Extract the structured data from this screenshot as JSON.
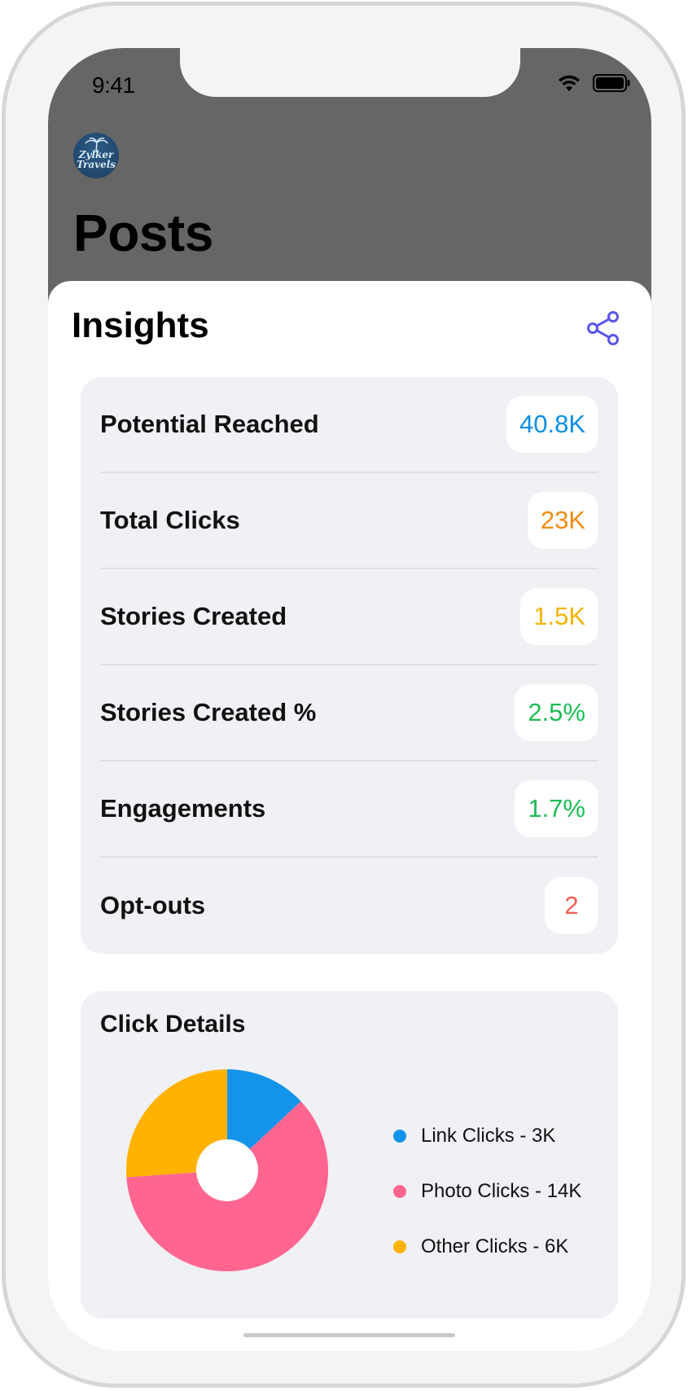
{
  "status": {
    "time": "9:41"
  },
  "header": {
    "title": "Posts",
    "avatar_line1": "Zylker",
    "avatar_line2": "Travels"
  },
  "insights": {
    "title": "Insights",
    "share_icon": "share-icon",
    "stats": [
      {
        "label": "Potential Reached",
        "value": "40.8K",
        "color": "#0a8ee6"
      },
      {
        "label": "Total Clicks",
        "value": "23K",
        "color": "#f28c0f"
      },
      {
        "label": "Stories Created",
        "value": "1.5K",
        "color": "#f5b400"
      },
      {
        "label": "Stories Created %",
        "value": "2.5%",
        "color": "#1cbd55"
      },
      {
        "label": "Engagements",
        "value": "1.7%",
        "color": "#1cbd55"
      },
      {
        "label": "Opt-outs",
        "value": "2",
        "color": "#f35b55"
      }
    ]
  },
  "click_details": {
    "title": "Click Details",
    "legend": [
      "Link Clicks - 3K",
      "Photo Clicks - 14K",
      "Other Clicks - 6K"
    ]
  },
  "chart_data": {
    "type": "pie",
    "donut": true,
    "categories": [
      "Link Clicks",
      "Photo Clicks",
      "Other Clicks"
    ],
    "values": [
      3,
      14,
      6
    ],
    "colors": [
      "#1394ea",
      "#fe6690",
      "#ffb300"
    ],
    "title": "Click Details",
    "legend_position": "right"
  }
}
